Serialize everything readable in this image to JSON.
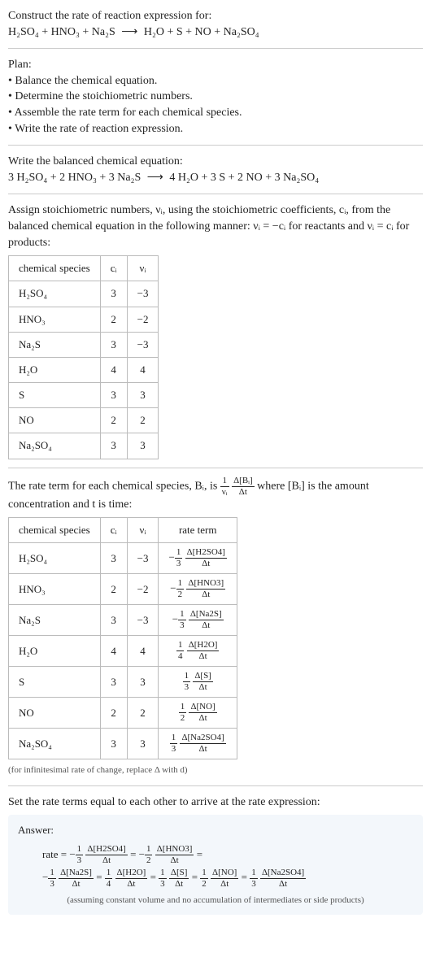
{
  "intro": {
    "line1": "Construct the rate of reaction expression for:",
    "equation_lhs": "H₂SO₄ + HNO₃ + Na₂S",
    "arrow": "⟶",
    "equation_rhs": "H₂O + S + NO + Na₂SO₄"
  },
  "plan": {
    "heading": "Plan:",
    "items": [
      "• Balance the chemical equation.",
      "• Determine the stoichiometric numbers.",
      "• Assemble the rate term for each chemical species.",
      "• Write the rate of reaction expression."
    ]
  },
  "balanced": {
    "heading": "Write the balanced chemical equation:",
    "lhs": "3 H₂SO₄ + 2 HNO₃ + 3 Na₂S",
    "arrow": "⟶",
    "rhs": "4 H₂O + 3 S + 2 NO + 3 Na₂SO₄"
  },
  "assign_text_1": "Assign stoichiometric numbers, νᵢ, using the stoichiometric coefficients, cᵢ, from the balanced chemical equation in the following manner: νᵢ = −cᵢ for reactants and νᵢ = cᵢ for products:",
  "table1": {
    "headers": [
      "chemical species",
      "cᵢ",
      "νᵢ"
    ],
    "rows": [
      [
        "H₂SO₄",
        "3",
        "−3"
      ],
      [
        "HNO₃",
        "2",
        "−2"
      ],
      [
        "Na₂S",
        "3",
        "−3"
      ],
      [
        "H₂O",
        "4",
        "4"
      ],
      [
        "S",
        "3",
        "3"
      ],
      [
        "NO",
        "2",
        "2"
      ],
      [
        "Na₂SO₄",
        "3",
        "3"
      ]
    ]
  },
  "rate_term_text_a": "The rate term for each chemical species, Bᵢ, is ",
  "rate_term_frac_left_num": "1",
  "rate_term_frac_left_den": "νᵢ",
  "rate_term_frac_right_num": "Δ[Bᵢ]",
  "rate_term_frac_right_den": "Δt",
  "rate_term_text_b": " where [Bᵢ] is the amount concentration and t is time:",
  "table2": {
    "headers": [
      "chemical species",
      "cᵢ",
      "νᵢ",
      "rate term"
    ],
    "rows": [
      {
        "sp": "H₂SO₄",
        "c": "3",
        "v": "−3",
        "sign": "−",
        "fn": "1",
        "fd": "3",
        "dn": "Δ[H2SO4]",
        "dd": "Δt"
      },
      {
        "sp": "HNO₃",
        "c": "2",
        "v": "−2",
        "sign": "−",
        "fn": "1",
        "fd": "2",
        "dn": "Δ[HNO3]",
        "dd": "Δt"
      },
      {
        "sp": "Na₂S",
        "c": "3",
        "v": "−3",
        "sign": "−",
        "fn": "1",
        "fd": "3",
        "dn": "Δ[Na2S]",
        "dd": "Δt"
      },
      {
        "sp": "H₂O",
        "c": "4",
        "v": "4",
        "sign": "",
        "fn": "1",
        "fd": "4",
        "dn": "Δ[H2O]",
        "dd": "Δt"
      },
      {
        "sp": "S",
        "c": "3",
        "v": "3",
        "sign": "",
        "fn": "1",
        "fd": "3",
        "dn": "Δ[S]",
        "dd": "Δt"
      },
      {
        "sp": "NO",
        "c": "2",
        "v": "2",
        "sign": "",
        "fn": "1",
        "fd": "2",
        "dn": "Δ[NO]",
        "dd": "Δt"
      },
      {
        "sp": "Na₂SO₄",
        "c": "3",
        "v": "3",
        "sign": "",
        "fn": "1",
        "fd": "3",
        "dn": "Δ[Na2SO4]",
        "dd": "Δt"
      }
    ]
  },
  "infinitesimal_note": "(for infinitesimal rate of change, replace Δ with d)",
  "set_rate_text": "Set the rate terms equal to each other to arrive at the rate expression:",
  "answer": {
    "label": "Answer:",
    "prefix": "rate = ",
    "terms": [
      {
        "sign": "−",
        "fn": "1",
        "fd": "3",
        "dn": "Δ[H2SO4]",
        "dd": "Δt"
      },
      {
        "sign": "−",
        "fn": "1",
        "fd": "2",
        "dn": "Δ[HNO3]",
        "dd": "Δt"
      },
      {
        "sign": "−",
        "fn": "1",
        "fd": "3",
        "dn": "Δ[Na2S]",
        "dd": "Δt"
      },
      {
        "sign": "",
        "fn": "1",
        "fd": "4",
        "dn": "Δ[H2O]",
        "dd": "Δt"
      },
      {
        "sign": "",
        "fn": "1",
        "fd": "3",
        "dn": "Δ[S]",
        "dd": "Δt"
      },
      {
        "sign": "",
        "fn": "1",
        "fd": "2",
        "dn": "Δ[NO]",
        "dd": "Δt"
      },
      {
        "sign": "",
        "fn": "1",
        "fd": "3",
        "dn": "Δ[Na2SO4]",
        "dd": "Δt"
      }
    ],
    "note": "(assuming constant volume and no accumulation of intermediates or side products)"
  }
}
